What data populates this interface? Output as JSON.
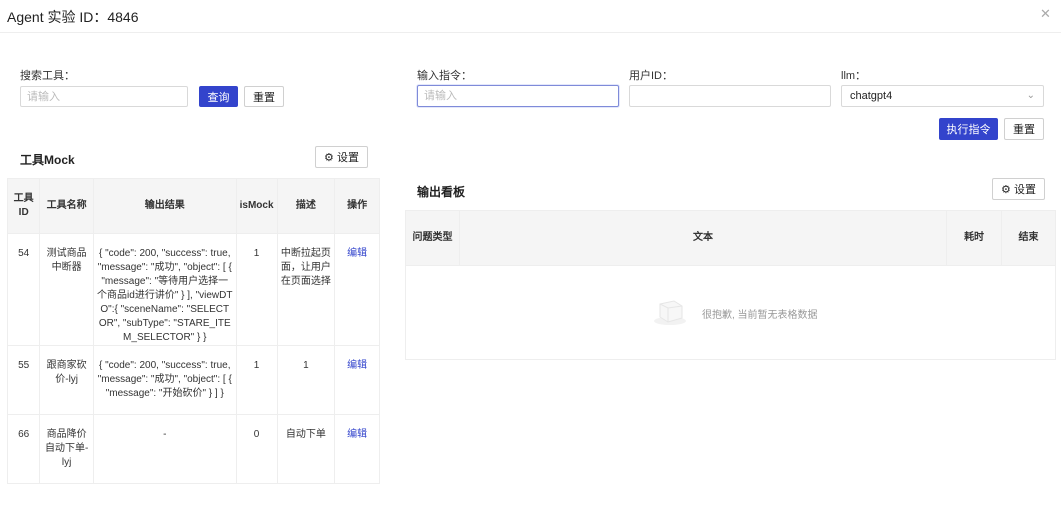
{
  "header": {
    "title": "Agent 实验 ID：4846",
    "close_icon": "close-icon"
  },
  "search": {
    "label": "搜索工具：",
    "placeholder": "请输入",
    "query_button": "查询",
    "reset_button": "重置"
  },
  "command": {
    "instruction_label": "输入指令：",
    "instruction_placeholder": "请输入",
    "user_id_label": "用户ID：",
    "user_id_value": "",
    "llm_label": "llm：",
    "llm_value": "chatgpt4",
    "execute_button": "执行指令",
    "reset_button": "重置"
  },
  "tool_mock": {
    "title": "工具Mock",
    "settings_button": "设置",
    "columns": [
      "工具ID",
      "工具名称",
      "输出结果",
      "isMock",
      "描述",
      "操作"
    ],
    "rows": [
      {
        "id": "54",
        "name": "测试商品中断器",
        "output": "{ \"code\": 200, \"success\": true, \"message\": \"成功\", \"object\": [ { \"message\": \"等待用户选择一个商品id进行讲价\" } ], \"viewDTO\":{ \"sceneName\": \"SELECTOR\", \"subType\": \"STARE_ITEM_SELECTOR\" } }",
        "is_mock": "1",
        "desc": "中断拉起页面，让用户在页面选择",
        "action": "编辑"
      },
      {
        "id": "55",
        "name": "跟商家砍价-lyj",
        "output": "{ \"code\": 200, \"success\": true, \"message\": \"成功\", \"object\": [ { \"message\": \"开始砍价\" } ] }",
        "is_mock": "1",
        "desc": "1",
        "action": "编辑"
      },
      {
        "id": "66",
        "name": "商品降价自动下单-lyj",
        "output": "-",
        "is_mock": "0",
        "desc": "自动下单",
        "action": "编辑"
      }
    ]
  },
  "output_board": {
    "title": "输出看板",
    "settings_button": "设置",
    "columns": [
      "问题类型",
      "文本",
      "耗时",
      "结束"
    ],
    "empty_text": "很抱歉, 当前暂无表格数据"
  }
}
